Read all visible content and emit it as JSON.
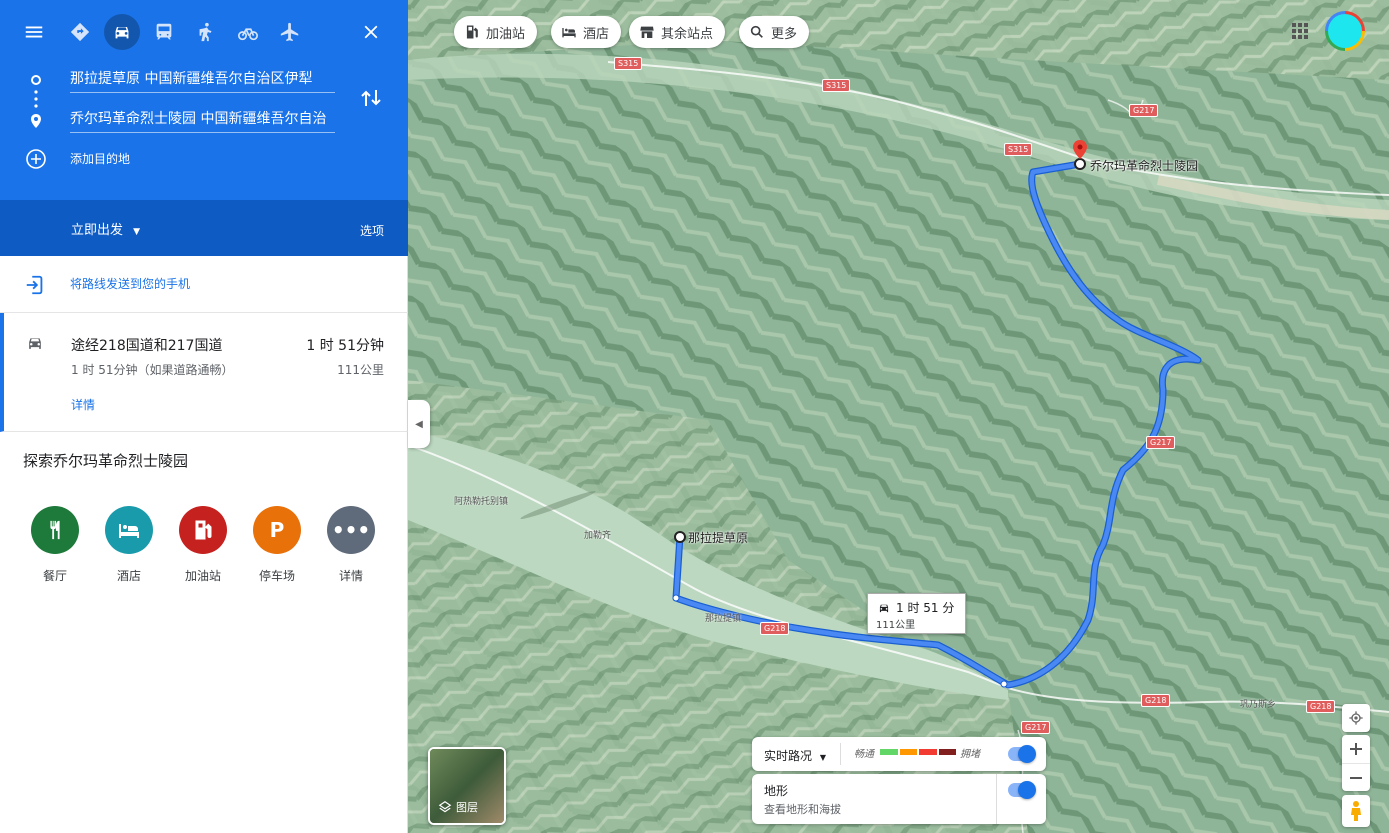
{
  "directions": {
    "origin": "那拉提草原 中国新疆维吾尔自治区伊犁",
    "destination": "乔尔玛革命烈士陵园 中国新疆维吾尔自治",
    "add_destination": "添加目的地",
    "depart_label": "立即出发",
    "options_label": "选项"
  },
  "send_to_phone": "将路线发送到您的手机",
  "route": {
    "name": "途经218国道和217国道",
    "time": "1 时 51分钟",
    "subtitle": "1 时 51分钟（如果道路通畅）",
    "distance": "111公里",
    "details": "详情"
  },
  "explore": {
    "title": "探索乔尔玛革命烈士陵园",
    "items": [
      {
        "label": "餐厅",
        "icon": "restaurant-icon",
        "color": "#1e7a3a"
      },
      {
        "label": "酒店",
        "icon": "hotel-icon",
        "color": "#1a9bab"
      },
      {
        "label": "加油站",
        "icon": "gas-station-icon",
        "color": "#c5221f"
      },
      {
        "label": "停车场",
        "icon": "parking-icon",
        "color": "#e8710a"
      },
      {
        "label": "详情",
        "icon": "more-icon",
        "color": "#5f6b7a"
      }
    ]
  },
  "chips": [
    "加油站",
    "酒店",
    "其余站点",
    "更多"
  ],
  "map": {
    "origin_label": "那拉提草原",
    "dest_label": "乔尔玛革命烈士陵园",
    "bubble_time": "1 时 51 分",
    "bubble_distance": "111公里",
    "roads": [
      "S315",
      "S315",
      "S315",
      "G217",
      "G217",
      "G217",
      "G218",
      "G218",
      "G218"
    ],
    "small_places": [
      "阿热勒托别镇",
      "加勒齐",
      "那拉提镇",
      "巩乃斯乡"
    ],
    "layers_label": "图层",
    "traffic_label": "实时路况",
    "traffic_fast": "畅通",
    "traffic_slow": "拥堵",
    "terrain_label": "地形",
    "terrain_sub": "查看地形和海拔"
  },
  "colors": {
    "accent": "#1a73e8",
    "route": "#4a89f3"
  }
}
